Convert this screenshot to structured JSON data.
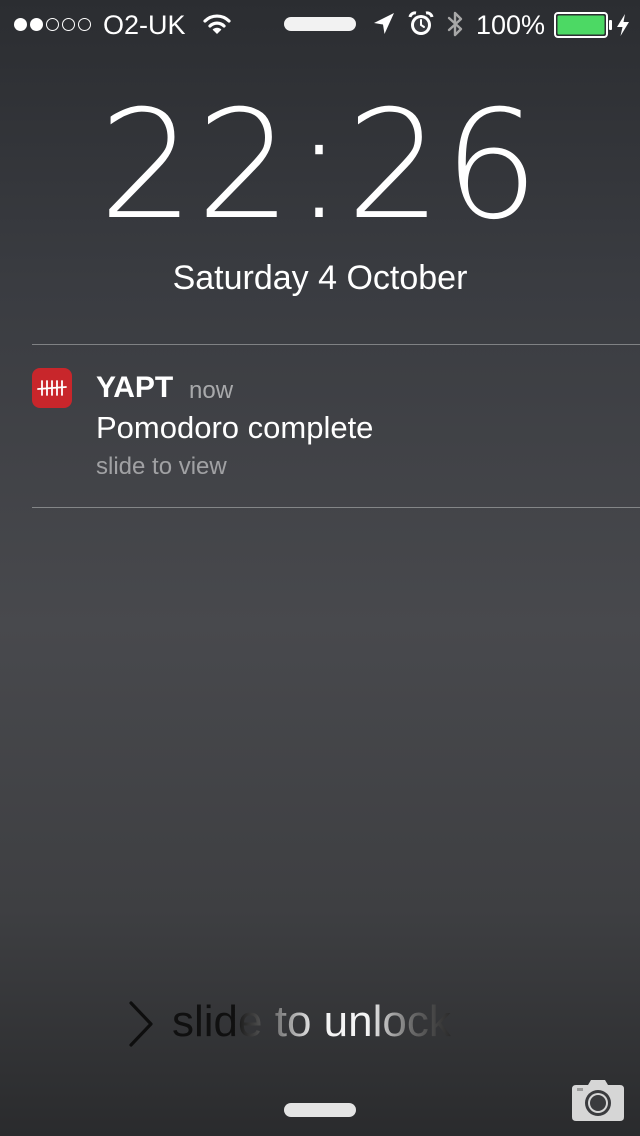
{
  "status_bar": {
    "signal_bars_filled": 2,
    "signal_bars_total": 5,
    "carrier": "O2-UK",
    "battery_percent": "100%",
    "icons": [
      "wifi-icon",
      "location-arrow-icon",
      "alarm-clock-icon",
      "bluetooth-icon",
      "battery-icon",
      "charging-bolt-icon"
    ],
    "battery_color": "#4cd964"
  },
  "lock_screen": {
    "time": "22:26",
    "date": "Saturday 4 October"
  },
  "notification": {
    "app_name": "YAPT",
    "time": "now",
    "message": "Pomodoro complete",
    "hint": "slide to view",
    "icon": "tally-marks-icon",
    "icon_color": "#c8262b"
  },
  "unlock": {
    "label": "slide to unlock",
    "icon": "chevron-right-icon"
  },
  "camera": {
    "icon": "camera-icon"
  }
}
